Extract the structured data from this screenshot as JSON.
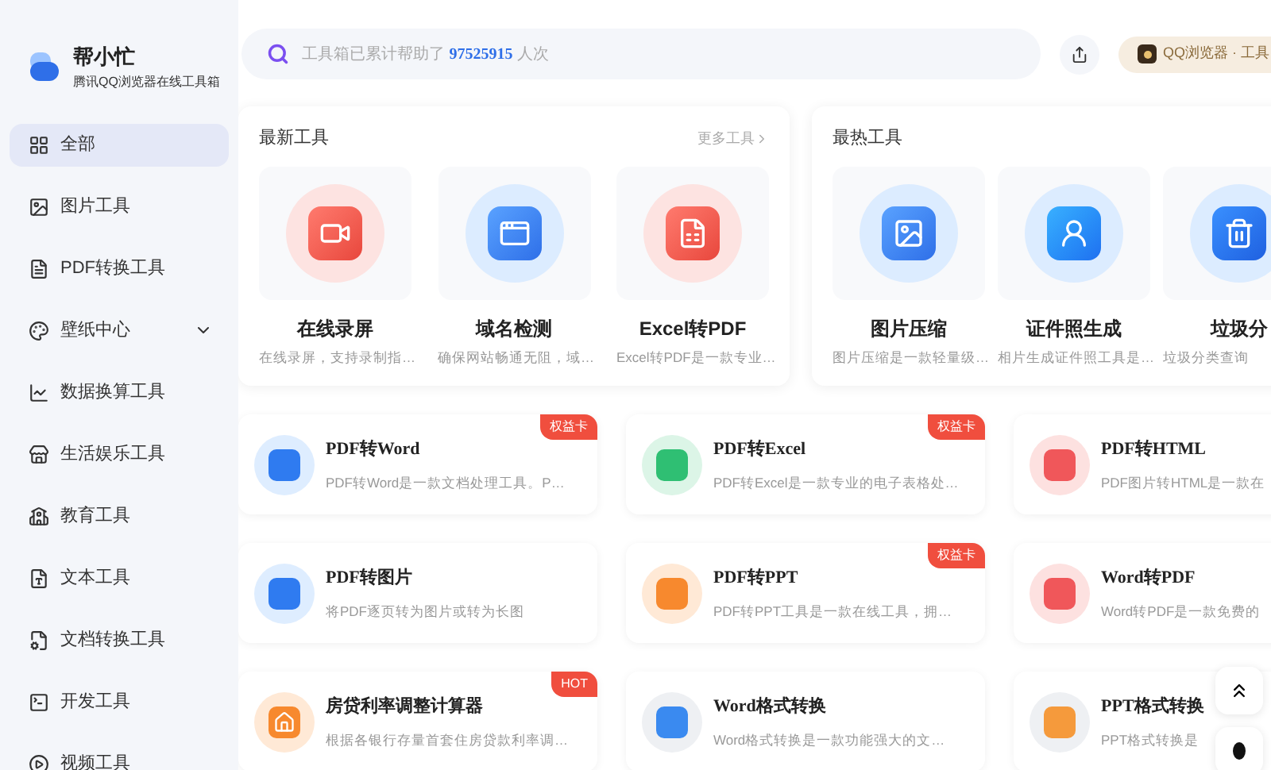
{
  "brand": {
    "name": "帮小忙",
    "subtitle": "腾讯QQ浏览器在线工具箱"
  },
  "sidebar": {
    "items": [
      {
        "label": "全部",
        "kind": "all",
        "selected": true
      },
      {
        "label": "图片工具",
        "kind": "image",
        "selected": false
      },
      {
        "label": "PDF转换工具",
        "kind": "pdf",
        "selected": false
      },
      {
        "label": "壁纸中心",
        "kind": "wallpaper",
        "selected": false,
        "expanded": false
      },
      {
        "label": "数据换算工具",
        "kind": "chart",
        "selected": false
      },
      {
        "label": "生活娱乐工具",
        "kind": "shop",
        "selected": false
      },
      {
        "label": "教育工具",
        "kind": "school",
        "selected": false
      },
      {
        "label": "文本工具",
        "kind": "text",
        "selected": false
      },
      {
        "label": "文档转换工具",
        "kind": "doc",
        "selected": false
      },
      {
        "label": "开发工具",
        "kind": "dev",
        "selected": false
      },
      {
        "label": "视频工具",
        "kind": "video",
        "selected": false
      }
    ]
  },
  "search": {
    "prefix": "工具箱已累计帮助了",
    "count": "97525915",
    "suffix": "人次"
  },
  "browser_pill": {
    "label": "QQ浏览器 · 工具"
  },
  "newest": {
    "title": "最新工具",
    "more": "更多工具",
    "tools": [
      {
        "name": "在线录屏",
        "desc": "在线录屏，支持录制指…",
        "kind": "video"
      },
      {
        "name": "域名检测",
        "desc": "确保网站畅通无阻，域…",
        "kind": "domain"
      },
      {
        "name": "Excel转PDF",
        "desc": "Excel转PDF是一款专业…",
        "kind": "excel"
      }
    ]
  },
  "hottest": {
    "title": "最热工具",
    "tools": [
      {
        "name": "图片压缩",
        "desc": "图片压缩是一款轻量级…",
        "kind": "image"
      },
      {
        "name": "证件照生成",
        "desc": "相片生成证件照工具是…",
        "kind": "idphoto"
      },
      {
        "name": "垃圾分",
        "desc": "垃圾分类查询",
        "kind": "trash"
      }
    ]
  },
  "cards": [
    {
      "name": "PDF转Word",
      "desc": "PDF转Word是一款文档处理工具。P…",
      "kind": "word",
      "badge": "权益卡"
    },
    {
      "name": "PDF转Excel",
      "desc": "PDF转Excel是一款专业的电子表格处…",
      "kind": "excel",
      "badge": "权益卡"
    },
    {
      "name": "PDF转HTML",
      "desc": "PDF图片转HTML是一款在",
      "kind": "html"
    },
    {
      "name": "PDF转图片",
      "desc": "将PDF逐页转为图片或转为长图",
      "kind": "pdfimage"
    },
    {
      "name": "PDF转PPT",
      "desc": "PDF转PPT工具是一款在线工具，拥…",
      "kind": "ppt",
      "badge": "权益卡"
    },
    {
      "name": "Word转PDF",
      "desc": "Word转PDF是一款免费的",
      "kind": "wordpdf"
    },
    {
      "name": "房贷利率调整计算器",
      "desc": "根据各银行存量首套住房贷款利率调…",
      "kind": "house",
      "badge": "HOT"
    },
    {
      "name": "Word格式转换",
      "desc": "Word格式转换是一款功能强大的文…",
      "kind": "wordfile"
    },
    {
      "name": "PPT格式转换",
      "desc": "PPT格式转换是",
      "kind": "pptfile"
    }
  ]
}
